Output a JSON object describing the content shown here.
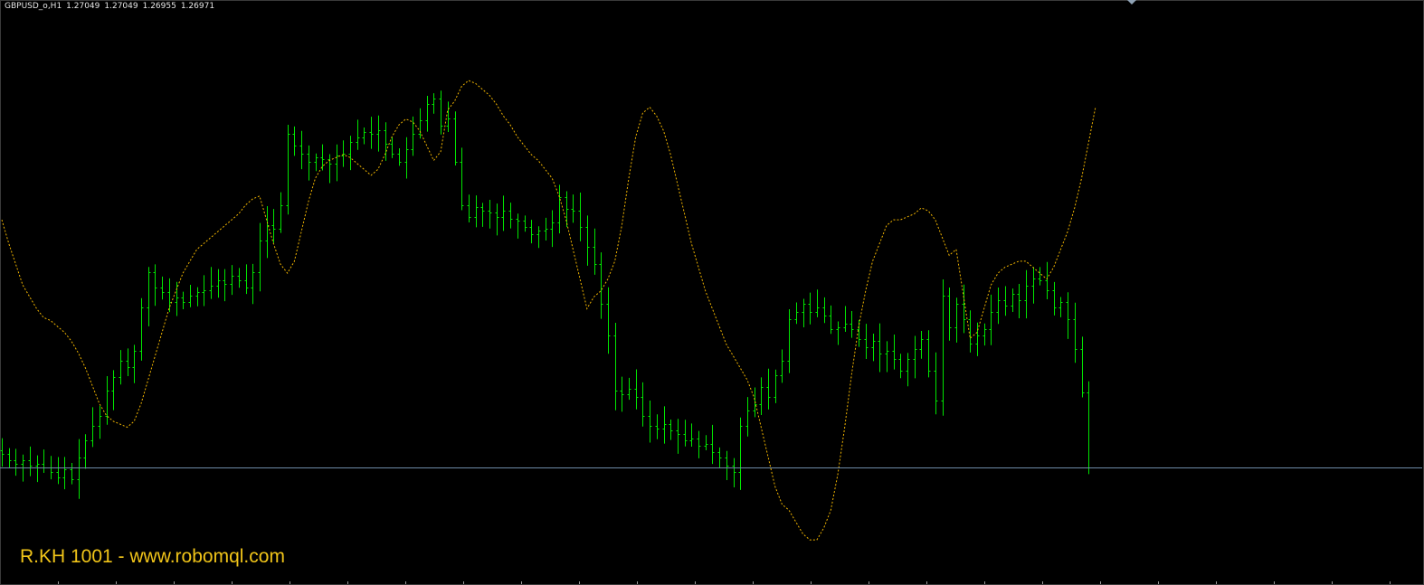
{
  "header": {
    "symbol": "GBPUSD_o,H1",
    "open": "1.27049",
    "high": "1.27049",
    "low": "1.26955",
    "close": "1.26971"
  },
  "watermark": "R.KH 1001 - www.robomql.com",
  "colors": {
    "background": "#000000",
    "bars": "#00e600",
    "indicator": "#f0b400",
    "price_line": "#6d8ba8",
    "watermark": "#f0c419"
  },
  "chart_data": {
    "type": "line",
    "title": "",
    "xlabel": "",
    "ylabel": "",
    "current_price": 1.26971,
    "grid": false,
    "legend": "none",
    "series": [
      {
        "kind": "ohlc",
        "closes": [
          1.2704,
          1.2701,
          1.2699,
          1.2701,
          1.2698,
          1.2699,
          1.2697,
          1.2695,
          1.2692,
          1.2696,
          1.2691,
          1.2702,
          1.2711,
          1.2718,
          1.2723,
          1.2736,
          1.2743,
          1.2751,
          1.2748,
          1.2756,
          1.2778,
          1.2796,
          1.2788,
          1.2786,
          1.2781,
          1.2783,
          1.2781,
          1.2784,
          1.2786,
          1.2787,
          1.2789,
          1.2792,
          1.279,
          1.2794,
          1.2792,
          1.2788,
          1.2796,
          1.2812,
          1.282,
          1.2818,
          1.283,
          1.2866,
          1.286,
          1.2856,
          1.2852,
          1.2854,
          1.2853,
          1.2851,
          1.2855,
          1.2856,
          1.2862,
          1.2864,
          1.2867,
          1.2866,
          1.2868,
          1.2861,
          1.2856,
          1.2852,
          1.2858,
          1.2866,
          1.2873,
          1.2881,
          1.2884,
          1.287,
          1.2874,
          1.2852,
          1.283,
          1.2824,
          1.2829,
          1.2827,
          1.2826,
          1.2824,
          1.2827,
          1.2823,
          1.2822,
          1.2819,
          1.2815,
          1.2817,
          1.2818,
          1.2821,
          1.2834,
          1.2828,
          1.2827,
          1.2819,
          1.2809,
          1.28,
          1.278,
          1.2764,
          1.2736,
          1.2734,
          1.2737,
          1.2733,
          1.2723,
          1.2718,
          1.2717,
          1.2719,
          1.2716,
          1.2714,
          1.2711,
          1.2712,
          1.2708,
          1.2709,
          1.2705,
          1.2702,
          1.2698,
          1.2695,
          1.2718,
          1.2726,
          1.2729,
          1.2738,
          1.2733,
          1.2744,
          1.2751,
          1.2772,
          1.2776,
          1.278,
          1.2776,
          1.2778,
          1.2774,
          1.2767,
          1.2768,
          1.277,
          1.2767,
          1.2762,
          1.2758,
          1.2761,
          1.2755,
          1.2756,
          1.2752,
          1.2746,
          1.2752,
          1.2757,
          1.2762,
          1.2746,
          1.2731,
          1.2784,
          1.2768,
          1.278,
          1.2772,
          1.276,
          1.2764,
          1.2767,
          1.2776,
          1.2782,
          1.2779,
          1.2785,
          1.2782,
          1.2789,
          1.2793,
          1.2792,
          1.2787,
          1.2778,
          1.2781,
          1.2772,
          1.2757,
          1.2735,
          1.2697
        ],
        "price_range": [
          1.265,
          1.292
        ]
      },
      {
        "kind": "oscillator",
        "style": "dotted",
        "values": [
          70,
          62,
          55,
          48,
          44,
          40,
          37,
          36,
          34,
          32,
          29,
          25,
          20,
          14,
          8,
          4,
          2,
          1,
          0,
          2,
          8,
          16,
          24,
          32,
          40,
          46,
          52,
          56,
          60,
          62,
          64,
          66,
          68,
          70,
          72,
          75,
          77,
          78,
          70,
          62,
          55,
          52,
          56,
          66,
          76,
          84,
          88,
          90,
          91,
          92,
          91,
          89,
          87,
          85,
          87,
          92,
          98,
          102,
          104,
          103,
          100,
          95,
          90,
          93,
          107,
          110,
          115,
          117,
          116,
          114,
          112,
          109,
          105,
          102,
          98,
          95,
          92,
          90,
          87,
          84,
          78,
          70,
          60,
          50,
          40,
          44,
          46,
          50,
          56,
          68,
          84,
          98,
          106,
          108,
          105,
          100,
          92,
          82,
          72,
          62,
          54,
          46,
          40,
          34,
          28,
          24,
          20,
          16,
          10,
          0,
          -10,
          -20,
          -26,
          -28,
          -32,
          -36,
          -38,
          -38,
          -34,
          -28,
          -16,
          0,
          18,
          34,
          46,
          56,
          62,
          68,
          70,
          70,
          71,
          72,
          74,
          73,
          70,
          64,
          58,
          60,
          45,
          30,
          32,
          40,
          48,
          52,
          54,
          55,
          56,
          56,
          54,
          52,
          50,
          54,
          60,
          66,
          74,
          84,
          96,
          108
        ],
        "value_range": [
          -45,
          135
        ]
      }
    ]
  }
}
